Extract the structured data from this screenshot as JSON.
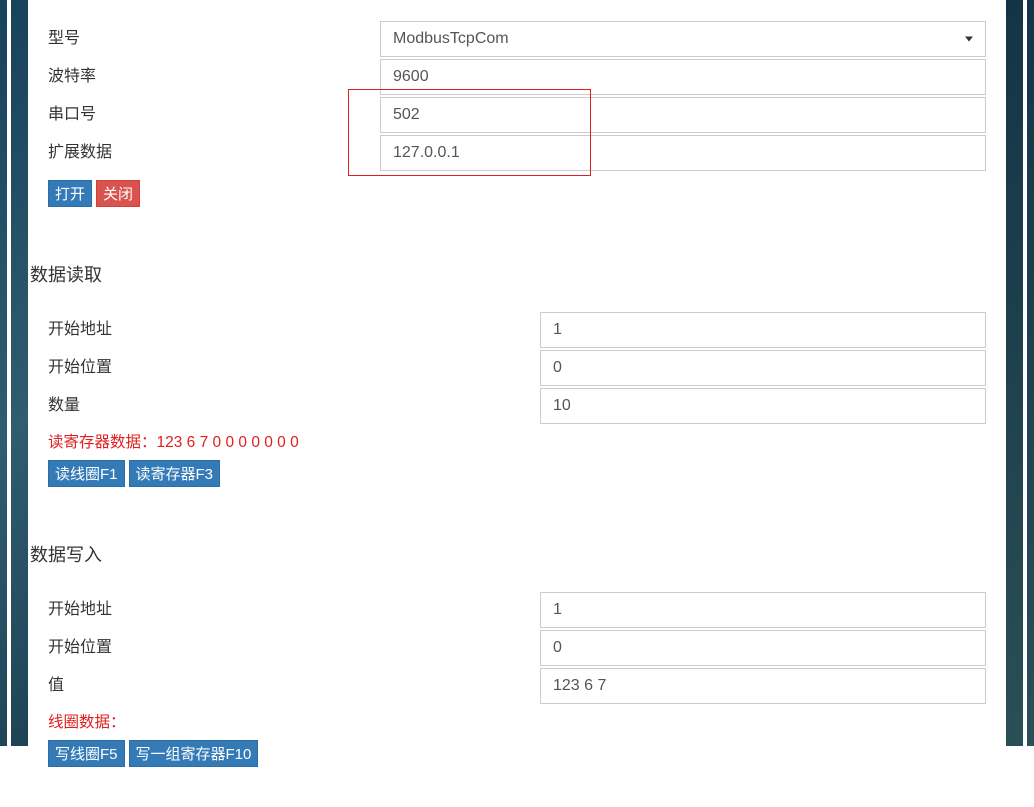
{
  "connection": {
    "fields": {
      "model": {
        "label": "型号",
        "value": "ModbusTcpCom"
      },
      "baud": {
        "label": "波特率",
        "value": "9600"
      },
      "port": {
        "label": "串口号",
        "value": "502"
      },
      "ext": {
        "label": "扩展数据",
        "value": "127.0.0.1"
      }
    },
    "buttons": {
      "open": "打开",
      "close": "关闭"
    }
  },
  "read": {
    "title": "数据读取",
    "fields": {
      "addr": {
        "label": "开始地址",
        "value": "1"
      },
      "pos": {
        "label": "开始位置",
        "value": "0"
      },
      "count": {
        "label": "数量",
        "value": "10"
      }
    },
    "result_label": "读寄存器数据：",
    "result_value": "123 6 7 0 0 0 0 0 0 0",
    "buttons": {
      "read_coil": "读线圈F1",
      "read_reg": "读寄存器F3"
    }
  },
  "write": {
    "title": "数据写入",
    "fields": {
      "addr": {
        "label": "开始地址",
        "value": "1"
      },
      "pos": {
        "label": "开始位置",
        "value": "0"
      },
      "val": {
        "label": "值",
        "value": "123 6 7"
      }
    },
    "result_label": "线圈数据：",
    "buttons": {
      "write_coil": "写线圈F5",
      "write_regs": "写一组寄存器F10"
    }
  }
}
